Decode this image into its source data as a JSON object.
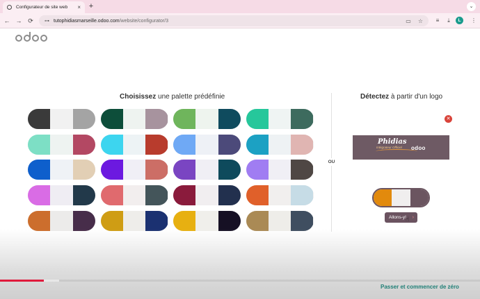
{
  "browser": {
    "tab_title": "Configurateur de site web",
    "tab_close": "×",
    "new_tab": "+",
    "tab_menu": "⌄",
    "back": "←",
    "forward": "→",
    "reload": "⟳",
    "site_info": "⊶",
    "url_host": "tutophidiasmarseille.odoo.com",
    "url_path": "/website/configurator/3",
    "avatar_letter": "L",
    "menu": "⋮"
  },
  "page": {
    "left_title_bold": "Choisissez",
    "left_title_rest": " une palette prédéfinie",
    "right_title_bold": "Détectez",
    "right_title_rest": " à partir d'un logo",
    "separator": "OU",
    "remove_logo": "✕",
    "logo_brand": "Phidias",
    "logo_tagline": "Intégrateur Officiel",
    "logo_partner": "odoo",
    "go_button_label": "Allons-y!",
    "go_button_arrow": "›",
    "skip_link": "Passer et commencer de zéro"
  },
  "palettes": [
    {
      "row": 0,
      "col": 0,
      "colors": [
        "#3a3a3a",
        "#f1f1f1",
        "#a4a4a4"
      ]
    },
    {
      "row": 0,
      "col": 1,
      "colors": [
        "#0d4e3a",
        "#eef3f0",
        "#a7939e"
      ]
    },
    {
      "row": 0,
      "col": 2,
      "colors": [
        "#6fb55c",
        "#eef4ee",
        "#0f4b5e"
      ]
    },
    {
      "row": 0,
      "col": 3,
      "colors": [
        "#26c79b",
        "#eff4f3",
        "#3d6b5e"
      ]
    },
    {
      "row": 1,
      "col": 0,
      "colors": [
        "#7ddfc5",
        "#eef3f1",
        "#b34863"
      ]
    },
    {
      "row": 1,
      "col": 1,
      "colors": [
        "#3dd5ef",
        "#edf3f5",
        "#b83c2d"
      ]
    },
    {
      "row": 1,
      "col": 2,
      "colors": [
        "#6fa9f5",
        "#eef1f6",
        "#4c4a7a"
      ]
    },
    {
      "row": 1,
      "col": 3,
      "colors": [
        "#1ca1c3",
        "#eef2f4",
        "#e0b5b2"
      ]
    },
    {
      "row": 2,
      "col": 0,
      "colors": [
        "#0e5fcc",
        "#eff2f6",
        "#e2cfb5"
      ]
    },
    {
      "row": 2,
      "col": 1,
      "colors": [
        "#6c19e0",
        "#f0eff6",
        "#cc6e66"
      ]
    },
    {
      "row": 2,
      "col": 2,
      "colors": [
        "#7a45c2",
        "#f0eff5",
        "#0e4a5c"
      ]
    },
    {
      "row": 2,
      "col": 3,
      "colors": [
        "#a07df2",
        "#f0eff5",
        "#4f4744"
      ]
    },
    {
      "row": 3,
      "col": 0,
      "colors": [
        "#d96ce5",
        "#efedf3",
        "#22394a"
      ]
    },
    {
      "row": 3,
      "col": 1,
      "colors": [
        "#e06a6e",
        "#f2eeee",
        "#44555a"
      ]
    },
    {
      "row": 3,
      "col": 2,
      "colors": [
        "#8a1b3c",
        "#f1eef0",
        "#22304e"
      ]
    },
    {
      "row": 3,
      "col": 3,
      "colors": [
        "#e0602a",
        "#f1efee",
        "#c6dce6"
      ]
    },
    {
      "row": 4,
      "col": 0,
      "colors": [
        "#cc6e2d",
        "#ecebea",
        "#472d4a"
      ]
    },
    {
      "row": 4,
      "col": 1,
      "colors": [
        "#cf9d14",
        "#eeedea",
        "#1b3171"
      ]
    },
    {
      "row": 4,
      "col": 2,
      "colors": [
        "#e7b011",
        "#f0efeb",
        "#161024"
      ]
    },
    {
      "row": 4,
      "col": 3,
      "colors": [
        "#aa8a55",
        "#eeede9",
        "#3f4e60"
      ]
    }
  ],
  "detected_palette": [
    "#e28a0d",
    "#f0eeee",
    "#6b5560"
  ],
  "video": {
    "played": 0.092,
    "loaded": 0.123
  }
}
